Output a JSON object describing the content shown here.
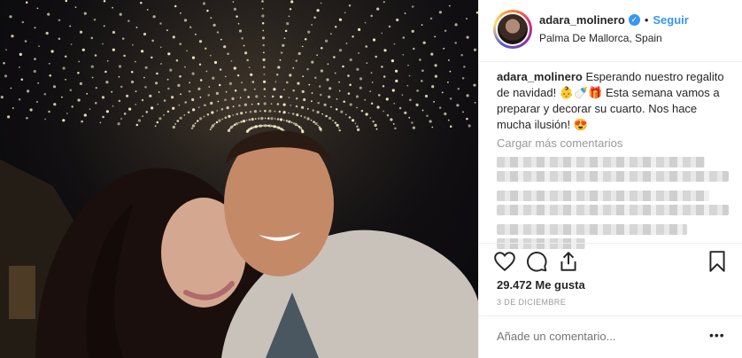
{
  "post": {
    "author": {
      "username": "adara_molinero",
      "verified_icon": "verified-badge-icon",
      "separator": "•",
      "follow_label": "Seguir",
      "location": "Palma De Mallorca, Spain"
    },
    "caption": {
      "username": "adara_molinero",
      "text": "Esperando nuestro regalito de navidad! 👶🍼🎁 Esta semana vamos a preparar y decorar su cuarto. Nos hace mucha ilusión! 😍"
    },
    "load_more_label": "Cargar más comentarios",
    "blurred_comment_rows": 8,
    "likes_label": "29.472 Me gusta",
    "date_label": "3 DE DICIEMBRE",
    "add_comment_placeholder": "Añade un comentario...",
    "more_options_label": "•••"
  },
  "icons": [
    "heart-icon",
    "comment-icon",
    "share-icon",
    "bookmark-icon"
  ],
  "colors": {
    "link_blue": "#3897f0",
    "muted_text": "#999999",
    "border": "#efefef"
  }
}
